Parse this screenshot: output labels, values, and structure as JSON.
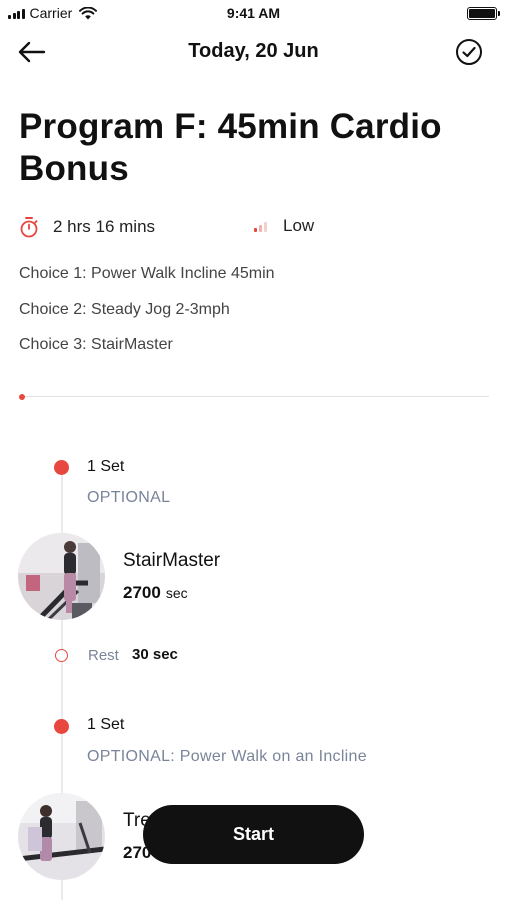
{
  "status_bar": {
    "carrier": "Carrier",
    "time": "9:41 AM",
    "icons": [
      "signal-icon",
      "wifi-icon",
      "battery-icon"
    ]
  },
  "nav": {
    "title": "Today, 20 Jun",
    "back_icon": "back-arrow-icon",
    "done_icon": "check-circle-icon"
  },
  "program": {
    "title": "Program F: 45min Cardio Bonus",
    "duration": "2 hrs 16 mins",
    "duration_icon": "stopwatch-icon",
    "level": "Low",
    "level_icon": "intensity-bars-icon",
    "choices": [
      "Choice 1: Power Walk Incline 45min",
      "Choice 2: Steady Jog 2-3mph",
      "Choice 3: StairMaster"
    ],
    "progress": 0
  },
  "timeline": [
    {
      "set": "1 Set",
      "note": "OPTIONAL",
      "exercise": "StairMaster",
      "duration_value": "2700",
      "duration_unit": "sec",
      "rest_label": "Rest",
      "rest_value": "30 sec"
    },
    {
      "set": "1 Set",
      "note": "OPTIONAL: Power Walk on an Incline",
      "exercise": "Tre",
      "duration_value": "270",
      "duration_unit": ""
    }
  ],
  "start_button": "Start",
  "colors": {
    "accent": "#e8473f",
    "text": "#111111",
    "muted": "#7a8499",
    "button": "#111111"
  }
}
